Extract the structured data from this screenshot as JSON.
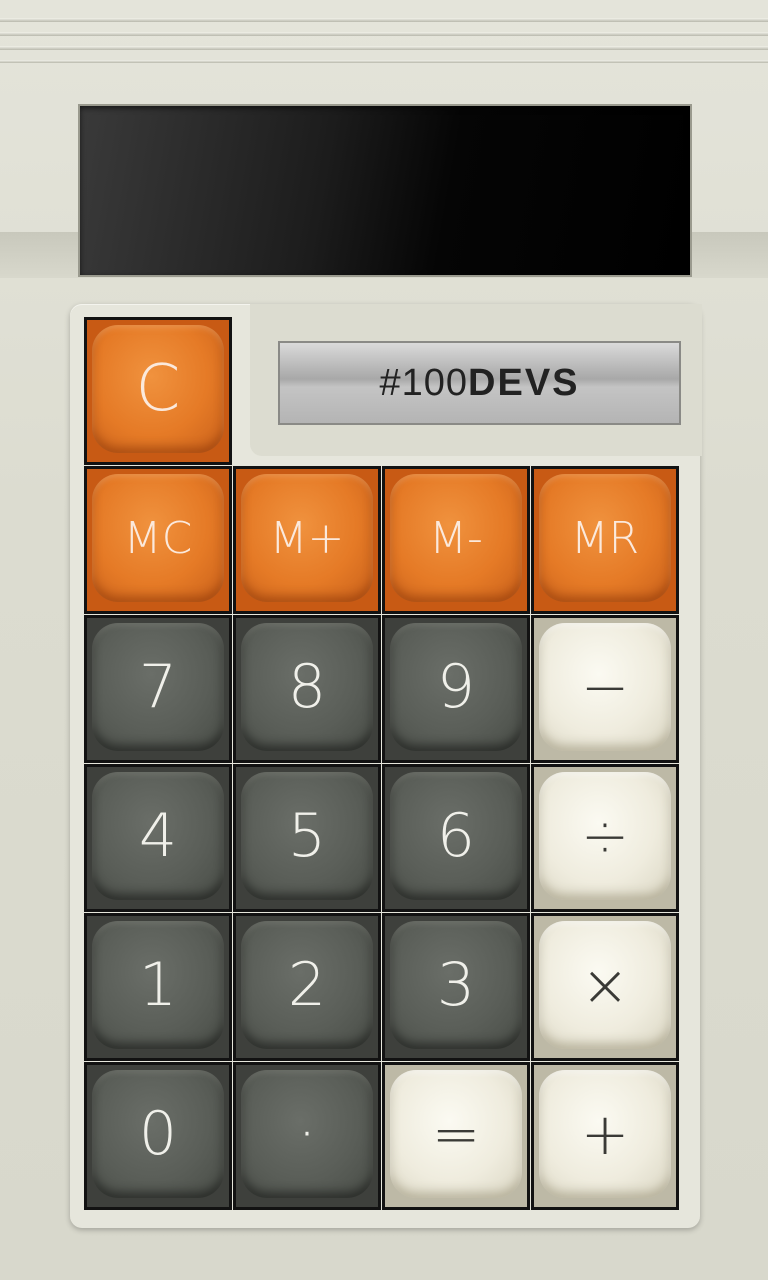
{
  "display": {
    "value": ""
  },
  "brand": {
    "prefix": "#100",
    "name": "DEVS"
  },
  "keys": {
    "clear": "C",
    "memory": [
      "MC",
      "M+",
      "M-",
      "MR"
    ],
    "row1": [
      "7",
      "8",
      "9",
      "−"
    ],
    "row2": [
      "4",
      "5",
      "6",
      "÷"
    ],
    "row3": [
      "1",
      "2",
      "3",
      "×"
    ],
    "row4": [
      "0",
      "·",
      "=",
      "+"
    ]
  },
  "colors": {
    "body": "#dcdcd0",
    "orange_key": "#e57a26",
    "gray_key": "#5a5e58",
    "cream_key": "#efecde",
    "display": "#000000"
  }
}
